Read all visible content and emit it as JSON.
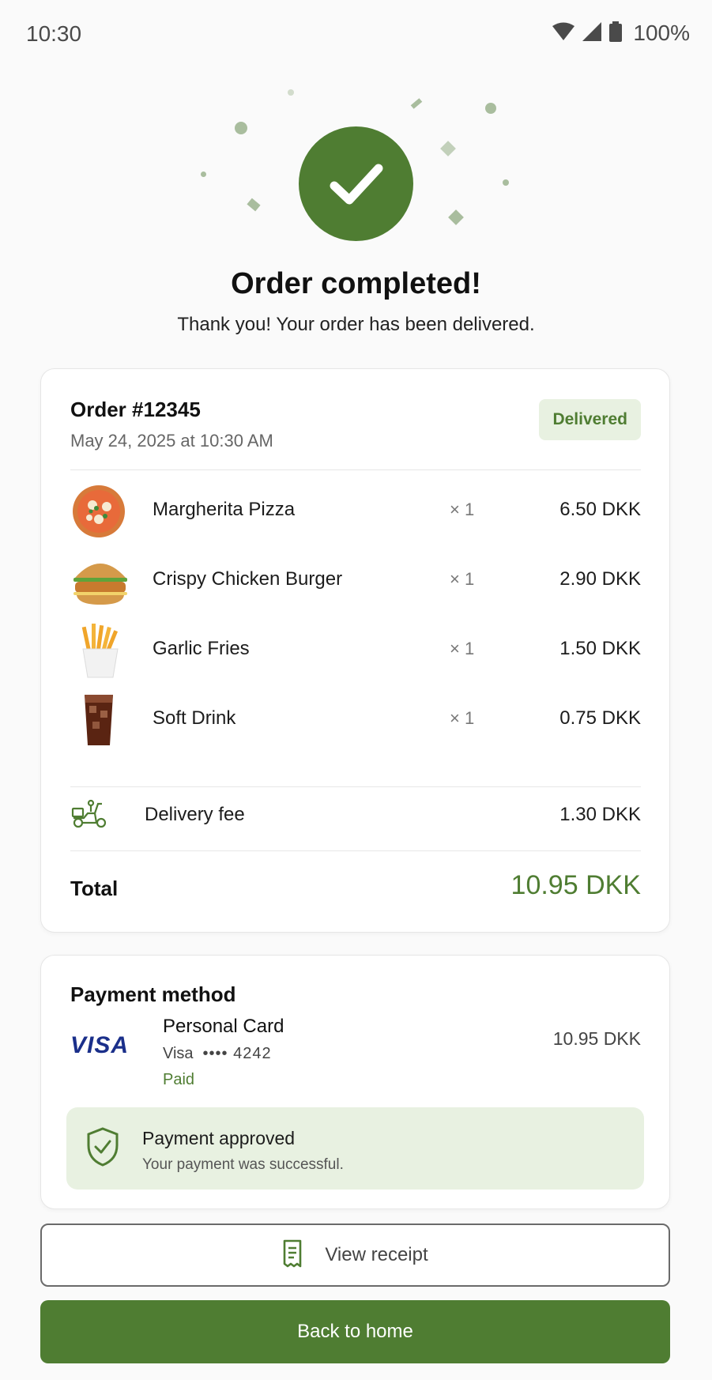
{
  "status_bar": {
    "time": "10:30",
    "battery": "100%"
  },
  "hero": {
    "title": "Order completed!",
    "subtitle": "Thank you! Your order has been delivered."
  },
  "order": {
    "number": "Order #12345",
    "date": "May 24, 2025 at 10:30 AM",
    "status": "Delivered",
    "items": [
      {
        "name": "Margherita Pizza",
        "qty": "× 1",
        "price": "6.50 DKK",
        "icon": "pizza-icon"
      },
      {
        "name": "Crispy Chicken Burger",
        "qty": "× 1",
        "price": "2.90 DKK",
        "icon": "burger-icon"
      },
      {
        "name": "Garlic Fries",
        "qty": "× 1",
        "price": "1.50 DKK",
        "icon": "fries-icon"
      },
      {
        "name": "Soft Drink",
        "qty": "× 1",
        "price": "0.75 DKK",
        "icon": "drink-icon"
      }
    ],
    "delivery_fee": {
      "label": "Delivery fee",
      "price": "1.30 DKK"
    },
    "total": {
      "label": "Total",
      "value": "10.95 DKK"
    }
  },
  "payment": {
    "title": "Payment method",
    "logo": "VISA",
    "card_name": "Personal Card",
    "card_brand": "Visa",
    "card_masked": "•••• 4242",
    "status": "Paid",
    "amount": "10.95 DKK",
    "approved_title": "Payment approved",
    "approved_subtitle": "Your payment was successful."
  },
  "actions": {
    "receipt_label": "View receipt",
    "home_label": "Back to home"
  },
  "colors": {
    "accent": "#4f7d32",
    "accent_light": "#e8f1e1",
    "visa_blue": "#1a2f8a"
  }
}
